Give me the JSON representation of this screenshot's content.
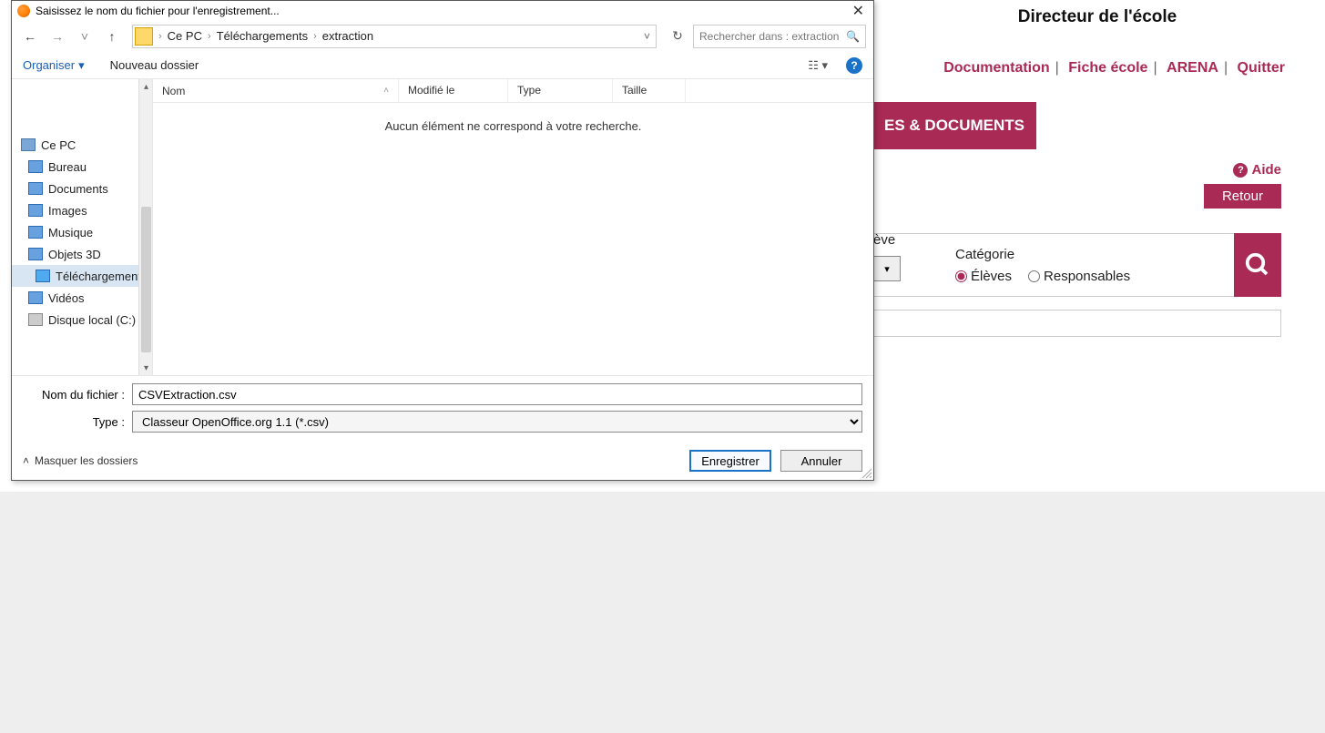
{
  "bg": {
    "headerTitle": "Directeur de l'école",
    "nav": {
      "doc": "Documentation",
      "fiche": "Fiche école",
      "arena": "ARENA",
      "quitter": "Quitter"
    },
    "tab": "ES & DOCUMENTS",
    "aide": "Aide",
    "retour": "Retour",
    "eleveLabel": "ève",
    "categorie": "Catégorie",
    "optEleves": "Élèves",
    "optResp": "Responsables"
  },
  "dlg": {
    "title": "Saisissez le nom du fichier pour l'enregistrement...",
    "breadcrumb": [
      "Ce PC",
      "Téléchargements",
      "extraction"
    ],
    "searchPlaceholder": "Rechercher dans : extraction",
    "organiser": "Organiser",
    "nouveauDossier": "Nouveau dossier",
    "cols": {
      "nom": "Nom",
      "modifie": "Modifié le",
      "type": "Type",
      "taille": "Taille"
    },
    "emptyMsg": "Aucun élément ne correspond à votre recherche.",
    "tree": {
      "root": "Ce PC",
      "items": [
        "Bureau",
        "Documents",
        "Images",
        "Musique",
        "Objets 3D",
        "Téléchargements",
        "Vidéos",
        "Disque local (C:)"
      ],
      "selectedIndex": 5
    },
    "fileNameLabel": "Nom du fichier :",
    "typeLabel": "Type :",
    "fileName": "CSVExtraction.csv",
    "fileType": "Classeur OpenOffice.org 1.1 (*.csv)",
    "masquer": "Masquer les dossiers",
    "enregistrer": "Enregistrer",
    "annuler": "Annuler"
  }
}
